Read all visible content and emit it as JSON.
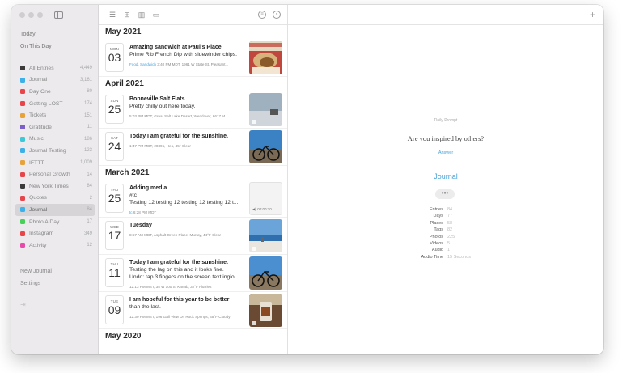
{
  "sidebar": {
    "nav": [
      "Today",
      "On This Day"
    ],
    "journals": [
      {
        "name": "All Entries",
        "count": "4,449",
        "color": "#3a3a3a"
      },
      {
        "name": "Journal",
        "count": "3,161",
        "color": "#3db0e8"
      },
      {
        "name": "Day One",
        "count": "80",
        "color": "#e8454b"
      },
      {
        "name": "Getting LOST",
        "count": "174",
        "color": "#e8454b"
      },
      {
        "name": "Tickets",
        "count": "151",
        "color": "#e8a23a"
      },
      {
        "name": "Gratitude",
        "count": "11",
        "color": "#7a5fc8"
      },
      {
        "name": "Music",
        "count": "186",
        "color": "#3dc8d8"
      },
      {
        "name": "Journal Testing",
        "count": "123",
        "color": "#3db0e8"
      },
      {
        "name": "IFTTT",
        "count": "1,009",
        "color": "#e8a23a"
      },
      {
        "name": "Personal Growth",
        "count": "14",
        "color": "#e8454b"
      },
      {
        "name": "New York Times",
        "count": "84",
        "color": "#3a3a3a"
      },
      {
        "name": "Quotes",
        "count": "2",
        "color": "#e8454b"
      },
      {
        "name": "Journal",
        "count": "84",
        "color": "#3db0e8"
      },
      {
        "name": "Photo A Day",
        "count": "17",
        "color": "#4ad05a"
      },
      {
        "name": "Instagram",
        "count": "349",
        "color": "#e8454b"
      },
      {
        "name": "Activity",
        "count": "12",
        "color": "#e84aa8"
      }
    ],
    "active_index": 12,
    "bottom": [
      "New Journal",
      "Settings"
    ],
    "collapse_glyph": "⇥"
  },
  "list": {
    "toolbar_icons": [
      "list-icon",
      "grid-icon",
      "map-icon",
      "calendar-icon"
    ],
    "toolbar_right": [
      "filter-icon",
      "search-icon"
    ],
    "sections": [
      {
        "month": "May 2021",
        "entries": [
          {
            "dow": "MON",
            "day": "03",
            "title": "Amazing sandwich at Paul's Place",
            "text": "Prime Rib French Dip with sidewinder chips.",
            "meta": "3:40 PM MDT, 1961 W State St, Pleasant...",
            "tag": "Food, Sandwich",
            "thumb": "sandwich"
          }
        ]
      },
      {
        "month": "April 2021",
        "entries": [
          {
            "dow": "SUN",
            "day": "25",
            "title": "Bonneville Salt Flats",
            "text": "Pretty chilly out here today.",
            "meta": "5:03 PM MDT, Great Salt Lake Desert, Wendover, 6617 M...",
            "tag": "",
            "thumb": "saltflats"
          },
          {
            "dow": "SAT",
            "day": "24",
            "title": "Today I am grateful for the sunshine.",
            "text": "",
            "meta": "1:47 PM MDT, 20395, Heo, 45° Clear",
            "tag": "",
            "thumb": "bike"
          }
        ]
      },
      {
        "month": "March 2021",
        "entries": [
          {
            "dow": "THU",
            "day": "25",
            "title": "Adding media",
            "text": "#tc",
            "text2": "Testing 12 testing 12 testing 12 testing 12 t...",
            "meta": "6:28 PM MDT",
            "tag": "tc",
            "thumb": "audio",
            "audio_label": "00:00:10"
          },
          {
            "dow": "WED",
            "day": "17",
            "title": "Tuesday",
            "text": "",
            "meta": "8:57 AM MDT, Asphalt Green Place, Murray, 44°F Clear",
            "tag": "",
            "thumb": "beach"
          },
          {
            "dow": "THU",
            "day": "11",
            "title": "Today I am grateful for the sunshine.",
            "text": "Testing the lag on this and it looks fine.",
            "text2": "Undo: tap 3 fingers on the screen text ingio...",
            "meta": "12:13 PM MST, 35 W 100 S, Kanab, 32°F Flurries",
            "tag": "",
            "thumb": "bike2"
          },
          {
            "dow": "TUE",
            "day": "09",
            "title": "I am hopeful for this year to be better",
            "text": "than the last.",
            "meta": "12:30 PM MST, 196 Gall View Dr, Rock Springs, 45°F Cloudy",
            "tag": "",
            "thumb": "coffee"
          }
        ]
      },
      {
        "month": "May 2020",
        "entries": []
      }
    ]
  },
  "detail": {
    "prompt_label": "Daily Prompt",
    "prompt": "Are you inspired by others?",
    "answer": "Answer",
    "journal_title": "Journal",
    "more": "•••",
    "add": "+",
    "stats": [
      {
        "k": "Entries",
        "v": "84"
      },
      {
        "k": "Days",
        "v": "77"
      },
      {
        "k": "Places",
        "v": "58"
      },
      {
        "k": "Tags",
        "v": "82"
      },
      {
        "k": "Photos",
        "v": "225"
      },
      {
        "k": "Videos",
        "v": "5"
      },
      {
        "k": "Audio",
        "v": "1"
      },
      {
        "k": "Audio Time",
        "v": "15 Seconds"
      }
    ]
  }
}
